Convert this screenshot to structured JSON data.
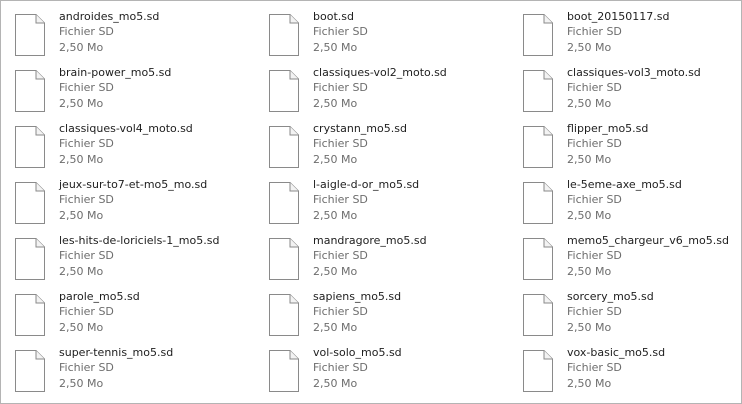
{
  "files": [
    {
      "name": "androides_mo5.sd",
      "type": "Fichier SD",
      "size": "2,50 Mo"
    },
    {
      "name": "boot.sd",
      "type": "Fichier SD",
      "size": "2,50 Mo"
    },
    {
      "name": "boot_20150117.sd",
      "type": "Fichier SD",
      "size": "2,50 Mo"
    },
    {
      "name": "brain-power_mo5.sd",
      "type": "Fichier SD",
      "size": "2,50 Mo"
    },
    {
      "name": "classiques-vol2_moto.sd",
      "type": "Fichier SD",
      "size": "2,50 Mo"
    },
    {
      "name": "classiques-vol3_moto.sd",
      "type": "Fichier SD",
      "size": "2,50 Mo"
    },
    {
      "name": "classiques-vol4_moto.sd",
      "type": "Fichier SD",
      "size": "2,50 Mo"
    },
    {
      "name": "crystann_mo5.sd",
      "type": "Fichier SD",
      "size": "2,50 Mo"
    },
    {
      "name": "flipper_mo5.sd",
      "type": "Fichier SD",
      "size": "2,50 Mo"
    },
    {
      "name": "jeux-sur-to7-et-mo5_mo.sd",
      "type": "Fichier SD",
      "size": "2,50 Mo"
    },
    {
      "name": "l-aigle-d-or_mo5.sd",
      "type": "Fichier SD",
      "size": "2,50 Mo"
    },
    {
      "name": "le-5eme-axe_mo5.sd",
      "type": "Fichier SD",
      "size": "2,50 Mo"
    },
    {
      "name": "les-hits-de-loriciels-1_mo5.sd",
      "type": "Fichier SD",
      "size": "2,50 Mo"
    },
    {
      "name": "mandragore_mo5.sd",
      "type": "Fichier SD",
      "size": "2,50 Mo"
    },
    {
      "name": "memo5_chargeur_v6_mo5.sd",
      "type": "Fichier SD",
      "size": "2,50 Mo"
    },
    {
      "name": "parole_mo5.sd",
      "type": "Fichier SD",
      "size": "2,50 Mo"
    },
    {
      "name": "sapiens_mo5.sd",
      "type": "Fichier SD",
      "size": "2,50 Mo"
    },
    {
      "name": "sorcery_mo5.sd",
      "type": "Fichier SD",
      "size": "2,50 Mo"
    },
    {
      "name": "super-tennis_mo5.sd",
      "type": "Fichier SD",
      "size": "2,50 Mo"
    },
    {
      "name": "vol-solo_mo5.sd",
      "type": "Fichier SD",
      "size": "2,50 Mo"
    },
    {
      "name": "vox-basic_mo5.sd",
      "type": "Fichier SD",
      "size": "2,50 Mo"
    }
  ],
  "icon": "generic-file-icon",
  "colors": {
    "name_text": "#1e1e1e",
    "meta_text": "#6d6d6d",
    "border": "#b4b4b4",
    "icon_stroke": "#8a8a8a",
    "icon_fill": "#ffffff"
  }
}
